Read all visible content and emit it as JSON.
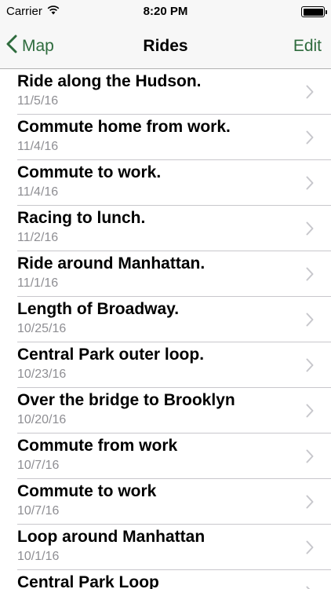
{
  "status_bar": {
    "carrier": "Carrier",
    "time": "8:20 PM"
  },
  "nav": {
    "back_label": "Map",
    "title": "Rides",
    "edit_label": "Edit"
  },
  "colors": {
    "accent": "#2e6b3d",
    "subtitle": "#8e8e93"
  },
  "rides": [
    {
      "title": "Ride along the Hudson.",
      "date": "11/5/16"
    },
    {
      "title": "Commute home from work.",
      "date": "11/4/16"
    },
    {
      "title": "Commute to work.",
      "date": "11/4/16"
    },
    {
      "title": "Racing to lunch.",
      "date": "11/2/16"
    },
    {
      "title": "Ride around Manhattan.",
      "date": "11/1/16"
    },
    {
      "title": "Length of Broadway.",
      "date": "10/25/16"
    },
    {
      "title": "Central Park outer loop.",
      "date": "10/23/16"
    },
    {
      "title": "Over the bridge to Brooklyn",
      "date": "10/20/16"
    },
    {
      "title": "Commute from work",
      "date": "10/7/16"
    },
    {
      "title": "Commute to work",
      "date": "10/7/16"
    },
    {
      "title": "Loop around Manhattan",
      "date": "10/1/16"
    },
    {
      "title": "Central Park Loop",
      "date": ""
    }
  ]
}
